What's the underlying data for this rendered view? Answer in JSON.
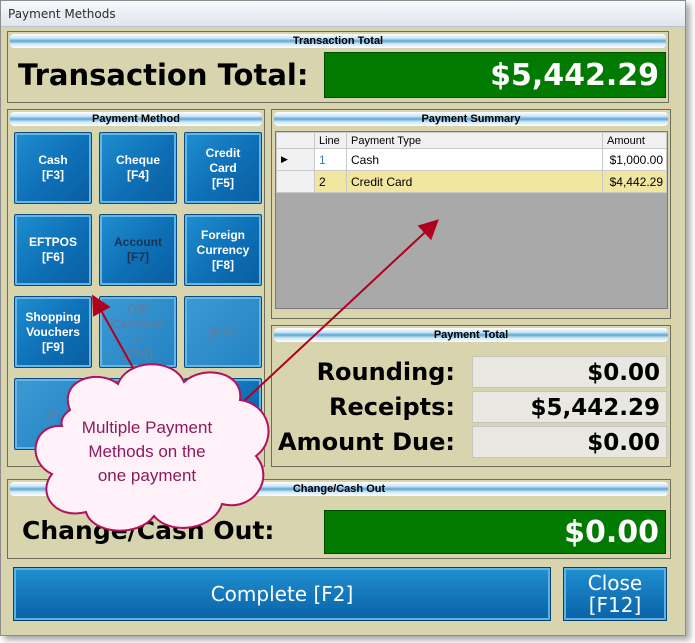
{
  "window": {
    "title": "Payment Methods"
  },
  "transaction_total": {
    "section_title": "Transaction Total",
    "label": "Transaction Total:",
    "value": "$5,442.29"
  },
  "payment_method": {
    "section_title": "Payment Method",
    "buttons": [
      {
        "label": "Cash\n[F3]",
        "state": "enabled"
      },
      {
        "label": "Cheque\n[F4]",
        "state": "enabled"
      },
      {
        "label": "Credit\nCard\n[F5]",
        "state": "enabled"
      },
      {
        "label": "EFTPOS\n[F6]",
        "state": "enabled"
      },
      {
        "label": "Account\n[F7]",
        "state": "dark"
      },
      {
        "label": "Foreign\nCurrency\n[F8]",
        "state": "enabled"
      },
      {
        "label": "Shopping\nVouchers\n[F9]",
        "state": "enabled"
      },
      {
        "label": "Gift\nCertificat\ne\n[F10]",
        "state": "disabled"
      },
      {
        "label": "[F11]",
        "state": "disabled"
      },
      {
        "label": "[A",
        "state": "disabled"
      },
      {
        "label": "",
        "state": "enabled"
      },
      {
        "label": "",
        "state": "enabled"
      }
    ]
  },
  "payment_summary": {
    "section_title": "Payment Summary",
    "columns": [
      "Line",
      "Payment Type",
      "Amount"
    ],
    "rows": [
      {
        "line": "1",
        "type": "Cash",
        "amount": "$1,000.00"
      },
      {
        "line": "2",
        "type": "Credit Card",
        "amount": "$4,442.29"
      }
    ]
  },
  "payment_total": {
    "section_title": "Payment Total",
    "rounding_label": "Rounding:",
    "rounding_value": "$0.00",
    "receipts_label": "Receipts:",
    "receipts_value": "$5,442.29",
    "amount_due_label": "Amount Due:",
    "amount_due_value": "$0.00"
  },
  "change": {
    "section_title": "Change/Cash Out",
    "label": "Change/Cash Out:",
    "value": "$0.00"
  },
  "actions": {
    "complete_label": "Complete [F2]",
    "close_label": "Close\n[F12]"
  },
  "annotation": {
    "text": "Multiple Payment\nMethods on the\none payment"
  },
  "colors": {
    "window_bg": "#d8d4ae",
    "total_green": "#007a00",
    "button_blue": "#0e6fb6",
    "selected_row": "#f0e6a0",
    "callout_text": "#8b1a5e",
    "callout_border": "#b0125f",
    "arrow": "#b00020"
  }
}
